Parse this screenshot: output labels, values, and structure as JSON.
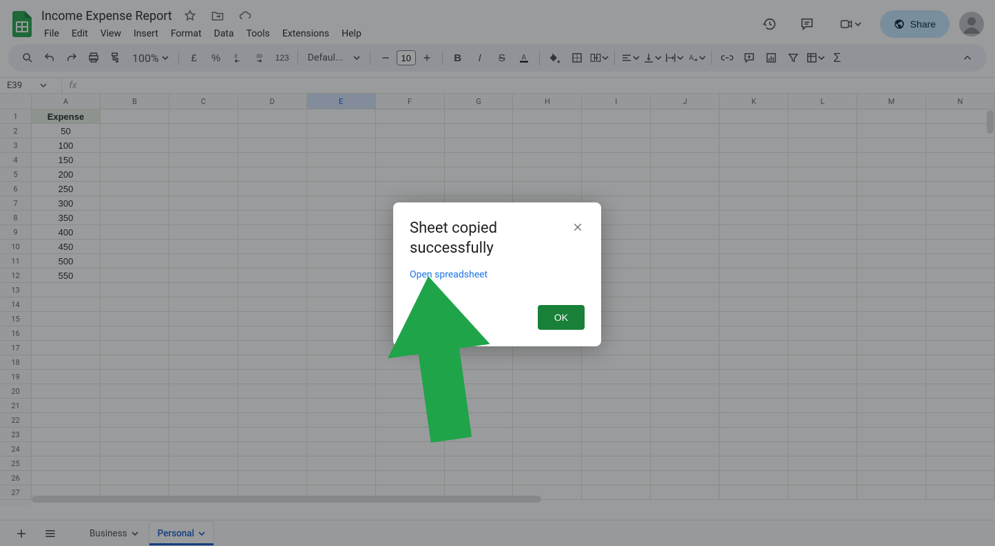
{
  "header": {
    "doc_title": "Income Expense Report",
    "menus": [
      "File",
      "Edit",
      "View",
      "Insert",
      "Format",
      "Data",
      "Tools",
      "Extensions",
      "Help"
    ],
    "share_label": "Share"
  },
  "toolbar": {
    "zoom": "100%",
    "currency_symbol": "£",
    "percent_symbol": "%",
    "num_123": "123",
    "font_name": "Defaul...",
    "font_size": "10"
  },
  "namebox": {
    "value": "E39"
  },
  "columns": [
    "A",
    "B",
    "C",
    "D",
    "E",
    "F",
    "G",
    "H",
    "I",
    "J",
    "K",
    "L",
    "M",
    "N"
  ],
  "selected_column_index": 4,
  "row_count": 27,
  "sheet_data": {
    "A": [
      "Expense",
      "50",
      "100",
      "150",
      "200",
      "250",
      "300",
      "350",
      "400",
      "450",
      "500",
      "550"
    ]
  },
  "tabs": {
    "sheets": [
      {
        "name": "Business",
        "active": false
      },
      {
        "name": "Personal",
        "active": true
      }
    ]
  },
  "dialog": {
    "title": "Sheet copied successfully",
    "link_text": "Open spreadsheet",
    "ok_label": "OK"
  },
  "annotation": {
    "color": "#1fa44a"
  }
}
